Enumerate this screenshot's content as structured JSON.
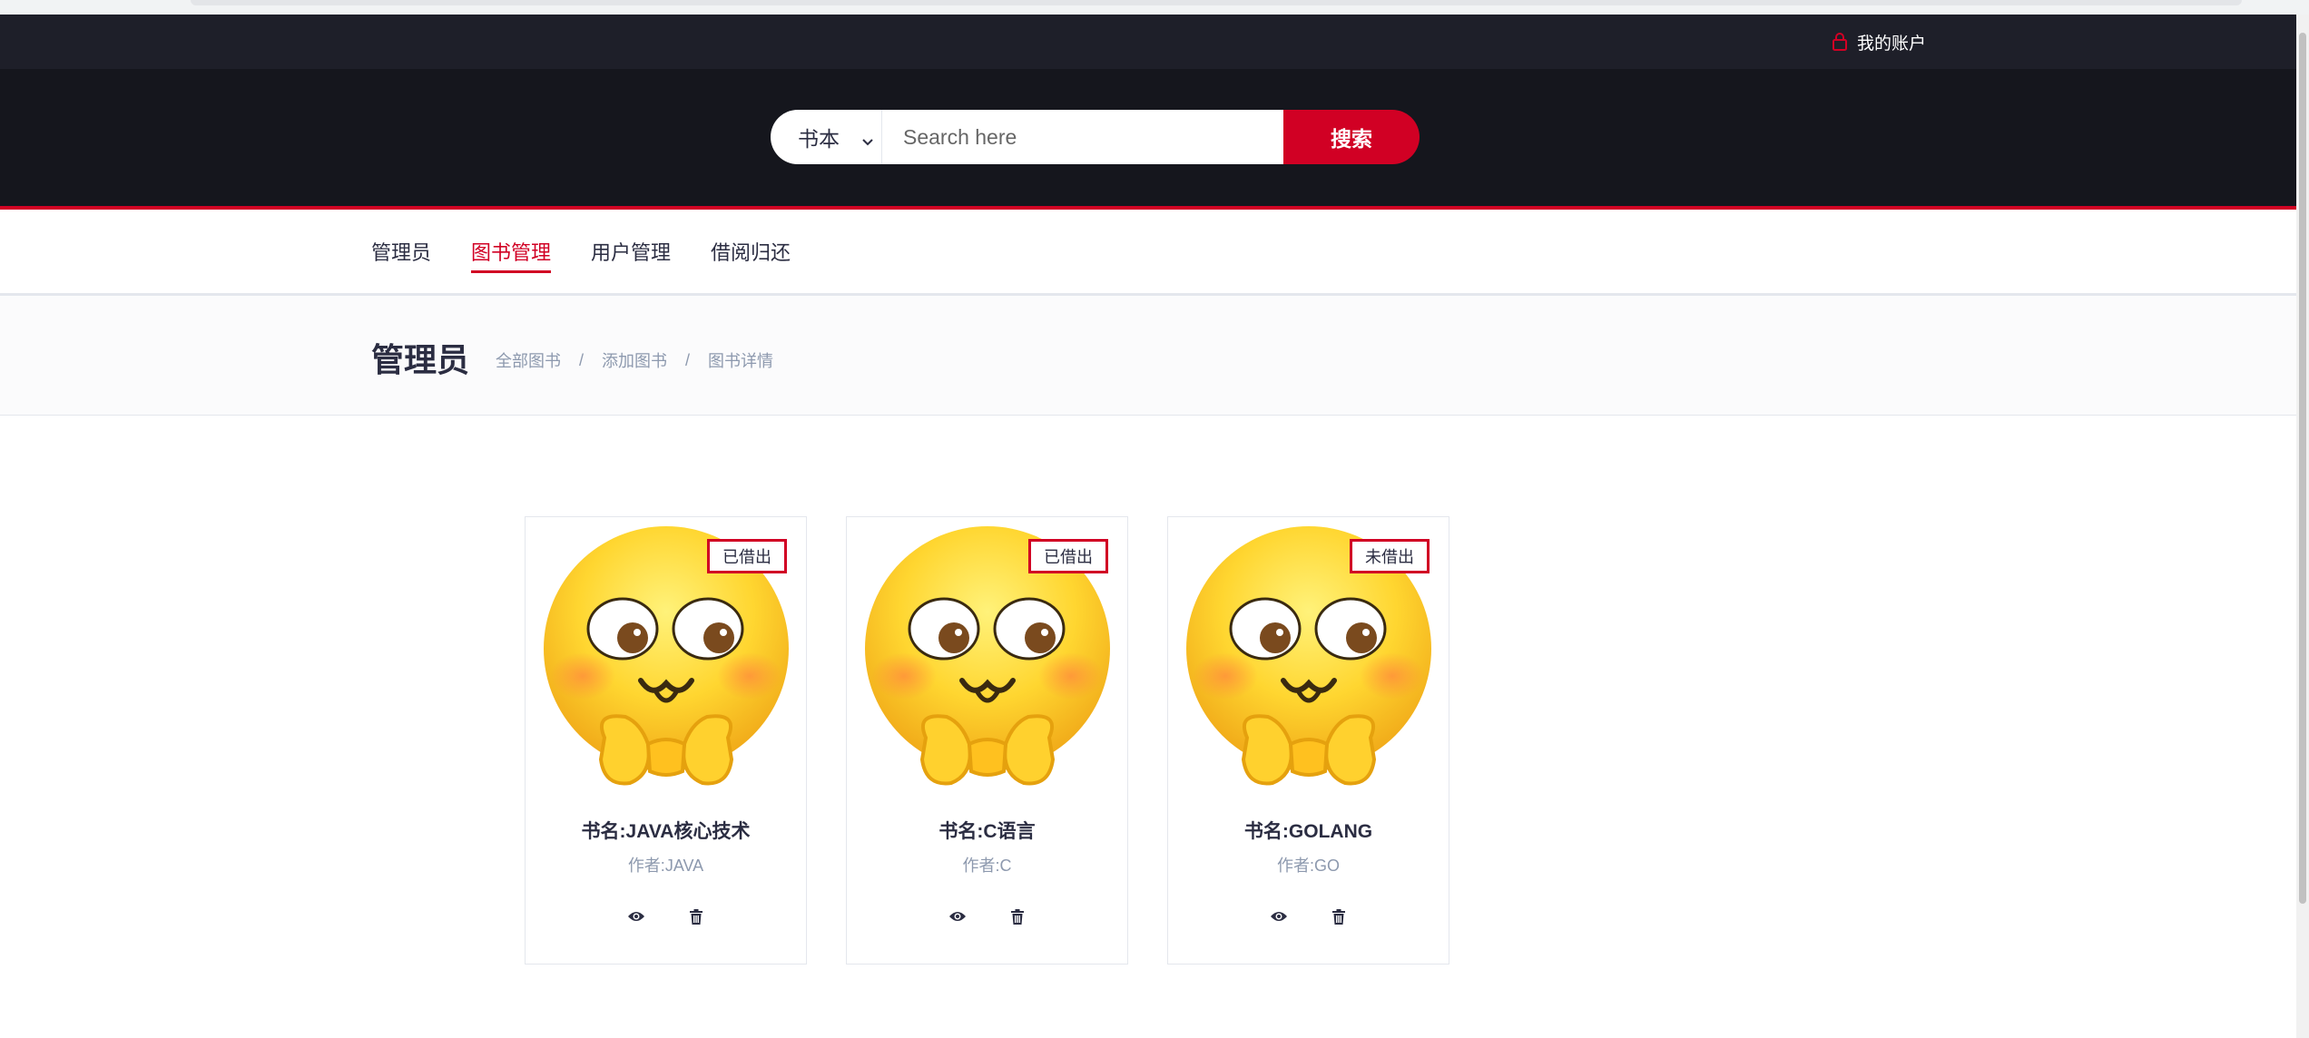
{
  "header": {
    "account_label": "我的账户",
    "account_icon": "lock-icon"
  },
  "search": {
    "category_selected": "书本",
    "placeholder": "Search here",
    "button_label": "搜索"
  },
  "nav": {
    "items": [
      {
        "label": "管理员"
      },
      {
        "label": "图书管理"
      },
      {
        "label": "用户管理"
      },
      {
        "label": "借阅归还"
      }
    ],
    "active_index": 1
  },
  "breadcrumb": {
    "title": "管理员",
    "items": [
      "全部图书",
      "添加图书",
      "图书详情"
    ],
    "separator": "/"
  },
  "books": [
    {
      "status": "已借出",
      "name": "书名:JAVA核心技术",
      "author": "作者:JAVA",
      "image": "emoji-face-icon"
    },
    {
      "status": "已借出",
      "name": "书名:C语言",
      "author": "作者:C",
      "image": "emoji-face-icon"
    },
    {
      "status": "未借出",
      "name": "书名:GOLANG",
      "author": "作者:GO",
      "image": "emoji-face-icon"
    }
  ],
  "colors": {
    "accent": "#D10024",
    "header_dark": "#15161D",
    "top_bar": "#1E1F29",
    "text": "#2B2D42",
    "muted": "#8D99AE"
  }
}
